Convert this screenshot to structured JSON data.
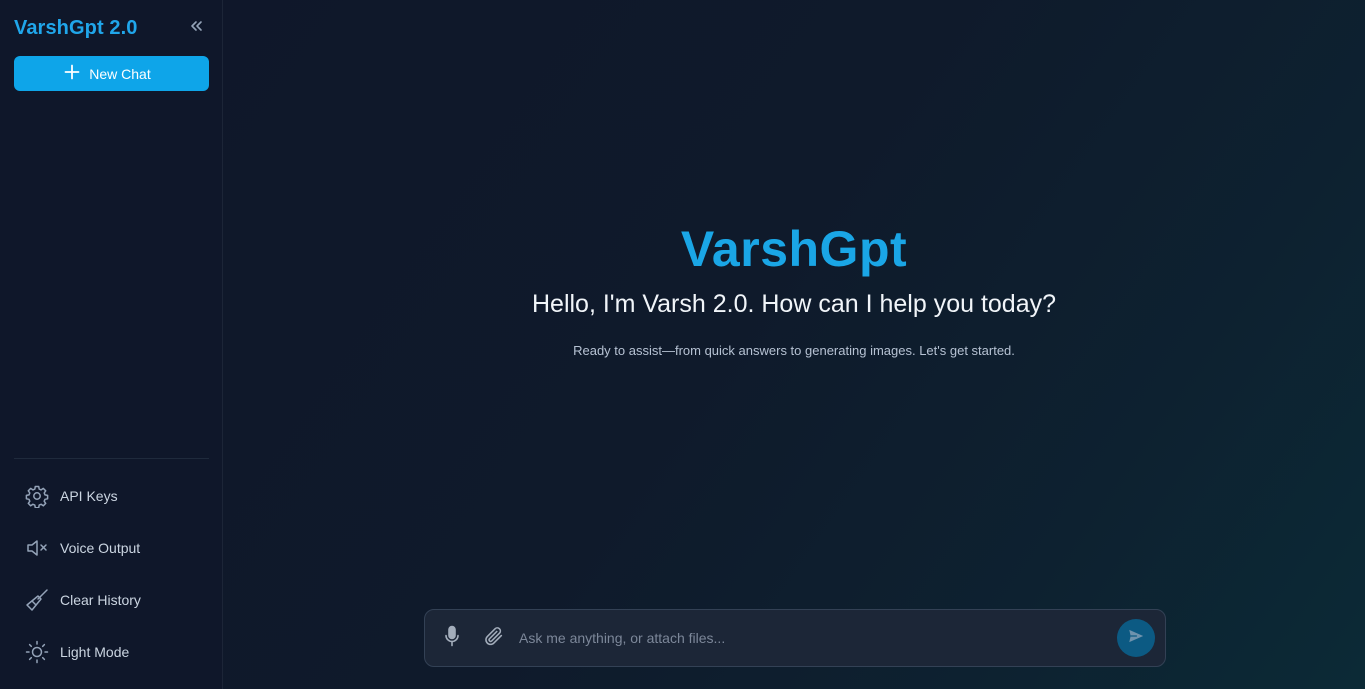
{
  "sidebar": {
    "brand": "VarshGpt 2.0",
    "new_chat_label": "New Chat",
    "collapse_icon": "chevrons-left-icon",
    "menu": [
      {
        "label": "API Keys",
        "icon": "gear-icon"
      },
      {
        "label": "Voice Output",
        "icon": "speaker-muted-icon"
      },
      {
        "label": "Clear History",
        "icon": "broom-icon"
      },
      {
        "label": "Light Mode",
        "icon": "sun-icon"
      }
    ]
  },
  "main": {
    "title": "VarshGpt",
    "greeting": "Hello, I'm Varsh 2.0. How can I help you today?",
    "subtitle": "Ready to assist—from quick answers to generating images. Let's get started."
  },
  "composer": {
    "placeholder": "Ask me anything, or attach files...",
    "value": "",
    "mic_icon": "microphone-icon",
    "attach_icon": "paperclip-icon",
    "send_icon": "send-icon"
  },
  "colors": {
    "accent": "#0ea5e9",
    "brand_text": "#20a6ea",
    "background": "#0f172a",
    "send_button": "#0c5a83"
  }
}
